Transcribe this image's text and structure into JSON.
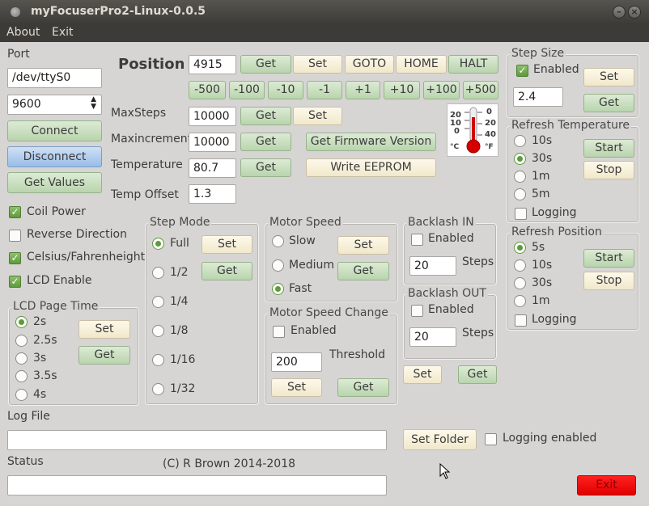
{
  "window": {
    "title": "myFocuserPro2-Linux-0.0.5"
  },
  "menu": {
    "about": "About",
    "exit": "Exit"
  },
  "port": {
    "label": "Port",
    "device": "/dev/ttyS0",
    "baud": "9600",
    "connect": "Connect",
    "disconnect": "Disconnect",
    "get_values": "Get Values"
  },
  "options": {
    "coil_power": "Coil Power",
    "reverse_direction": "Reverse Direction",
    "celsius_fahrenheit": "Celsius/Fahrenheight",
    "lcd_enable": "LCD Enable"
  },
  "lcd_page_time": {
    "title": "LCD Page Time",
    "options": [
      "2s",
      "2.5s",
      "3s",
      "3.5s",
      "4s"
    ],
    "selected": "2s",
    "set": "Set",
    "get": "Get"
  },
  "position": {
    "label": "Position",
    "value": "4915",
    "get": "Get",
    "set": "Set",
    "goto": "GOTO",
    "home": "HOME",
    "halt": "HALT",
    "steps": [
      "-500",
      "-100",
      "-10",
      "-1",
      "+1",
      "+10",
      "+100",
      "+500"
    ]
  },
  "maxsteps": {
    "label": "MaxSteps",
    "value": "10000",
    "get": "Get",
    "set": "Set"
  },
  "maxincrement": {
    "label": "Maxincrement",
    "value": "10000",
    "get": "Get"
  },
  "temperature": {
    "label": "Temperature",
    "value": "80.7",
    "get": "Get"
  },
  "temp_offset": {
    "label": "Temp Offset",
    "value": "1.3"
  },
  "firmware": {
    "get_version": "Get Firmware Version",
    "write_eeprom": "Write EEPROM"
  },
  "thermometer": {
    "c_scale": [
      "20",
      "10",
      "0"
    ],
    "f_scale": [
      "0",
      "20",
      "40"
    ],
    "c_unit": "°C",
    "f_unit": "°F"
  },
  "step_mode": {
    "title": "Step Mode",
    "options": [
      "Full",
      "1/2",
      "1/4",
      "1/8",
      "1/16",
      "1/32"
    ],
    "selected": "Full",
    "set": "Set",
    "get": "Get"
  },
  "motor_speed": {
    "title": "Motor Speed",
    "options": [
      "Slow",
      "Medium",
      "Fast"
    ],
    "selected": "Fast",
    "set": "Set",
    "get": "Get"
  },
  "motor_speed_change": {
    "title": "Motor Speed Change",
    "enabled": "Enabled",
    "value": "200",
    "threshold": "Threshold",
    "set": "Set",
    "get": "Get"
  },
  "backlash_in": {
    "title": "Backlash IN",
    "enabled": "Enabled",
    "value": "20",
    "steps": "Steps"
  },
  "backlash_out": {
    "title": "Backlash OUT",
    "enabled": "Enabled",
    "value": "20",
    "steps": "Steps"
  },
  "backlash": {
    "set": "Set",
    "get": "Get"
  },
  "step_size": {
    "title": "Step Size",
    "enabled": "Enabled",
    "value": "2.4",
    "set": "Set",
    "get": "Get"
  },
  "refresh_temperature": {
    "title": "Refresh Temperature",
    "options": [
      "10s",
      "30s",
      "1m",
      "5m"
    ],
    "selected": "30s",
    "logging": "Logging",
    "start": "Start",
    "stop": "Stop"
  },
  "refresh_position": {
    "title": "Refresh Position",
    "options": [
      "5s",
      "10s",
      "30s",
      "1m"
    ],
    "selected": "5s",
    "logging": "Logging",
    "start": "Start",
    "stop": "Stop"
  },
  "log": {
    "label": "Log File",
    "value": "",
    "set_folder": "Set Folder",
    "logging_enabled": "Logging enabled"
  },
  "status": {
    "label": "Status",
    "value": "",
    "copyright": "(C) R Brown 2014-2018"
  },
  "exit_button": "Exit"
}
